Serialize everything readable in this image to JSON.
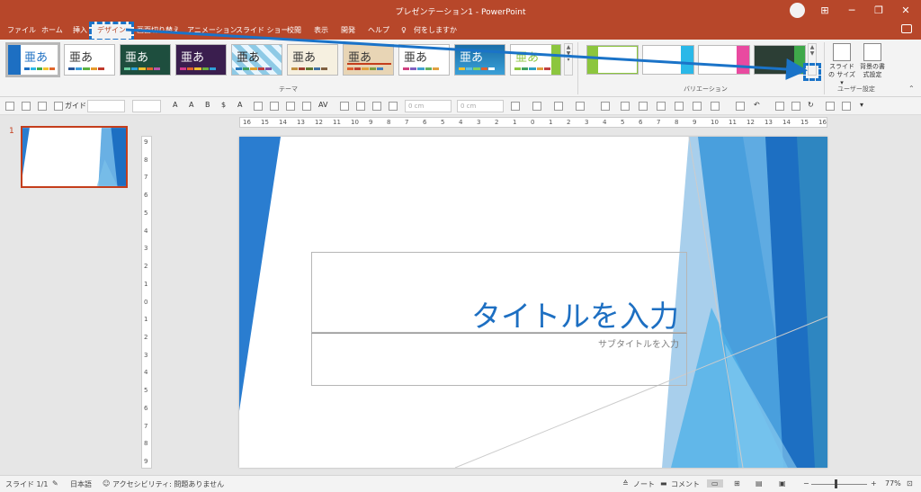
{
  "window": {
    "title": "プレゼンテーション1  -  PowerPoint",
    "minimize": "─",
    "restore": "❐",
    "close": "✕",
    "ribbon_display": "⊞"
  },
  "tabs": [
    {
      "label": "ファイル"
    },
    {
      "label": "ホーム"
    },
    {
      "label": "挿入"
    },
    {
      "label": "デザイン",
      "active": true
    },
    {
      "label": "画面切り替え"
    },
    {
      "label": "アニメーション"
    },
    {
      "label": "スライド ショー"
    },
    {
      "label": "校閲"
    },
    {
      "label": "表示"
    },
    {
      "label": "開発"
    },
    {
      "label": "ヘルプ"
    }
  ],
  "tell_me": "何をしますか",
  "ribbon": {
    "themes_label": "テーマ",
    "variants_label": "バリエーション",
    "user_settings_label": "ユーザー設定",
    "theme_sample_text": "亜あ",
    "slide_size_label": "スライドの サイズ ▾",
    "background_format_label": "背景の書 式設定"
  },
  "qat": {
    "guide_label": "ガイド",
    "measure1": "0 cm",
    "measure2": "0 cm"
  },
  "slide": {
    "number": "1",
    "title_placeholder": "タイトルを入力",
    "subtitle_placeholder": "サブタイトルを入力"
  },
  "ruler": {
    "h_ticks": [
      "16",
      "15",
      "14",
      "13",
      "12",
      "11",
      "10",
      "9",
      "8",
      "7",
      "6",
      "5",
      "4",
      "3",
      "2",
      "1",
      "0",
      "1",
      "2",
      "3",
      "4",
      "5",
      "6",
      "7",
      "8",
      "9",
      "10",
      "11",
      "12",
      "13",
      "14",
      "15",
      "16"
    ],
    "v_ticks": [
      "9",
      "8",
      "7",
      "6",
      "5",
      "4",
      "3",
      "2",
      "1",
      "0",
      "1",
      "2",
      "3",
      "4",
      "5",
      "6",
      "7",
      "8",
      "9"
    ]
  },
  "status": {
    "slide_info": "スライド 1/1",
    "language": "日本語",
    "accessibility": "アクセシビリティ: 問題ありません",
    "notes": "ノート",
    "comments": "コメント",
    "zoom_minus": "−",
    "zoom_plus": "+",
    "zoom": "77%"
  },
  "colors": {
    "accent": "#b7472a",
    "highlight": "#1a73c8",
    "title_blue": "#1d6fc2"
  }
}
